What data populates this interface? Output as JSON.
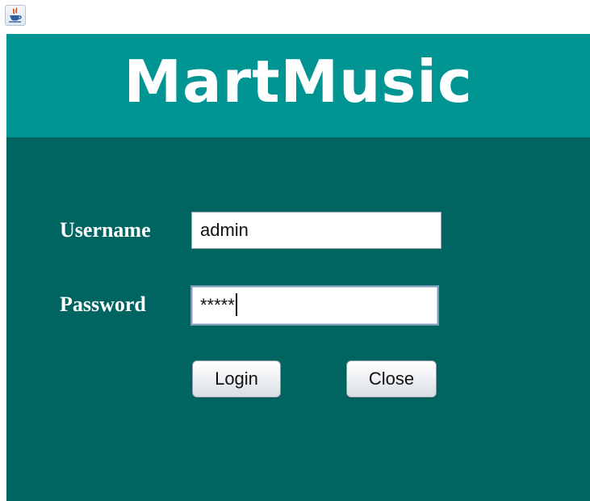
{
  "window": {
    "icon": "java-icon"
  },
  "header": {
    "logo_text": "MartMusic"
  },
  "form": {
    "username_label": "Username",
    "username_value": "admin",
    "password_label": "Password",
    "password_value": "*****"
  },
  "buttons": {
    "login_label": "Login",
    "close_label": "Close"
  },
  "colors": {
    "header_bg": "#009593",
    "panel_bg": "#006561",
    "text_light": "#ffffff"
  }
}
